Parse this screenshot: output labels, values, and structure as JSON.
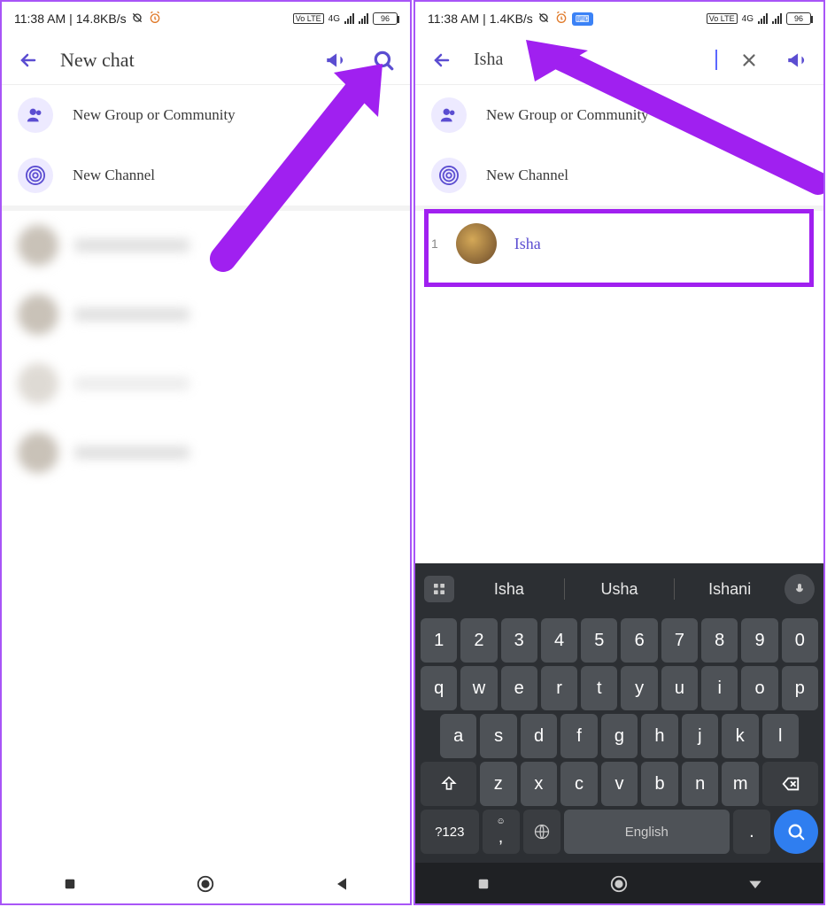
{
  "status": {
    "time": "11:38 AM",
    "speed_left": "14.8KB/s",
    "speed_right": "1.4KB/s",
    "net_label": "4G",
    "vo_label": "Vo LTE",
    "battery": "96"
  },
  "left_screen": {
    "title": "New chat",
    "menu": {
      "group": "New Group or Community",
      "channel": "New Channel"
    }
  },
  "right_screen": {
    "search_value": "Isha",
    "menu": {
      "group": "New Group or Community",
      "channel": "New Channel"
    },
    "result": {
      "index": "1",
      "name": "Isha"
    }
  },
  "keyboard": {
    "suggestions": [
      "Isha",
      "Usha",
      "Ishani"
    ],
    "row1": [
      "1",
      "2",
      "3",
      "4",
      "5",
      "6",
      "7",
      "8",
      "9",
      "0"
    ],
    "row2": [
      "q",
      "w",
      "e",
      "r",
      "t",
      "y",
      "u",
      "i",
      "o",
      "p"
    ],
    "row3": [
      "a",
      "s",
      "d",
      "f",
      "g",
      "h",
      "j",
      "k",
      "l"
    ],
    "row4": [
      "z",
      "x",
      "c",
      "v",
      "b",
      "n",
      "m"
    ],
    "symkey": "?123",
    "comma": ",",
    "space": "English",
    "dot": "."
  }
}
